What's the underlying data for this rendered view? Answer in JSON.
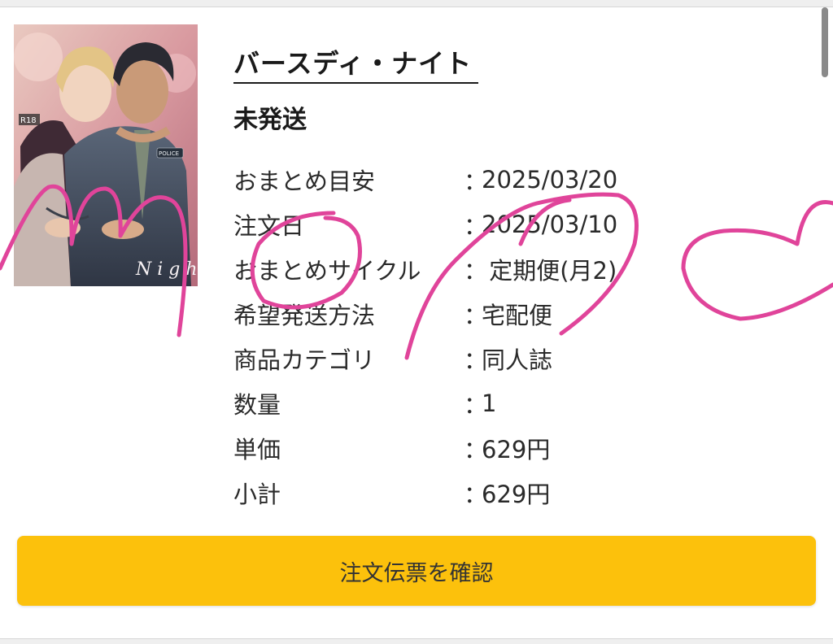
{
  "product": {
    "title": "バースディ・ナイト",
    "status": "未発送",
    "cover": {
      "rating_badge": "R18",
      "patch_text": "POLICE"
    }
  },
  "details": [
    {
      "label": "おまとめ目安",
      "separator": "：",
      "value": "2025/03/20"
    },
    {
      "label": "注文日",
      "separator": "：",
      "value": "2025/03/10"
    },
    {
      "label": "おまとめサイクル",
      "separator": "：",
      "value": " 定期便(月2)"
    },
    {
      "label": "希望発送方法",
      "separator": "：",
      "value": "宅配便"
    },
    {
      "label": "商品カテゴリ",
      "separator": "：",
      "value": "同人誌"
    },
    {
      "label": "数量",
      "separator": "：",
      "value": "1"
    },
    {
      "label": "単価",
      "separator": "：",
      "value": "629円"
    },
    {
      "label": "小計",
      "separator": "：",
      "value": "629円"
    }
  ],
  "actions": {
    "confirm_label": "注文伝票を確認"
  },
  "colors": {
    "button": "#fcc10c",
    "annotation": "#e0449a"
  }
}
